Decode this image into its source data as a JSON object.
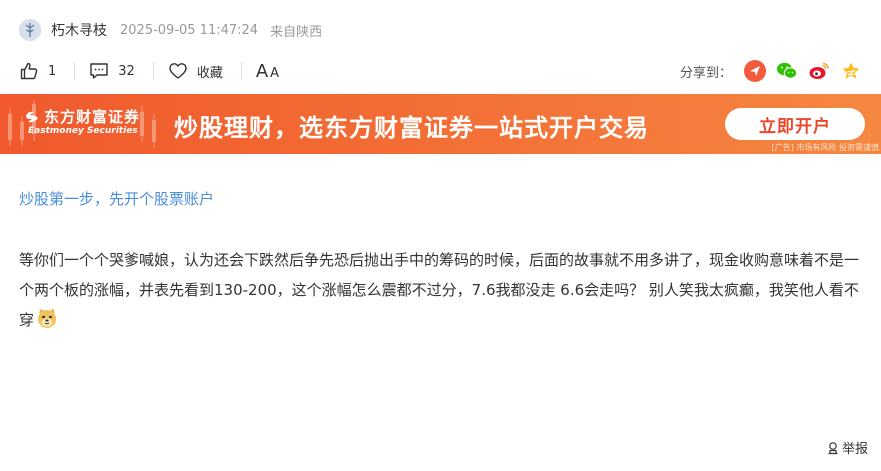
{
  "author": {
    "name": "朽木寻枝",
    "timestamp": "2025-09-05 11:47:24",
    "location": "来自陕西"
  },
  "actions": {
    "like_count": "1",
    "comment_count": "32",
    "favorite_label": "收藏",
    "font_size_label": "A",
    "font_size_small": "A",
    "share_label": "分享到："
  },
  "share_icons": [
    "toutiao-icon",
    "wechat-icon",
    "weibo-icon",
    "qzone-icon"
  ],
  "ad": {
    "brand_cn": "东方财富证券",
    "brand_en": "Eastmoney Securities",
    "slogan": "炒股理财，选东方财富证券一站式开户交易",
    "button": "立即开户",
    "note": "[广告] 市场有风险 投资需谨慎"
  },
  "hint_link": "炒股第一步，先开个股票账户",
  "post_text": "等你们一个个哭爹喊娘，认为还会下跌然后争先恐后抛出手中的筹码的时候，后面的故事就不用多讲了，现金收购意味着不是一个两个板的涨幅，并表先看到130-200，这个涨幅怎么震都不过分，7.6我都没走 6.6会走吗？ 别人笑我太疯癫，我笑他人看不穿",
  "report_label": "举报",
  "colors": {
    "accent_blue": "#4a8ed8",
    "banner_orange": "#f26a33",
    "button_text": "#e8482a"
  }
}
